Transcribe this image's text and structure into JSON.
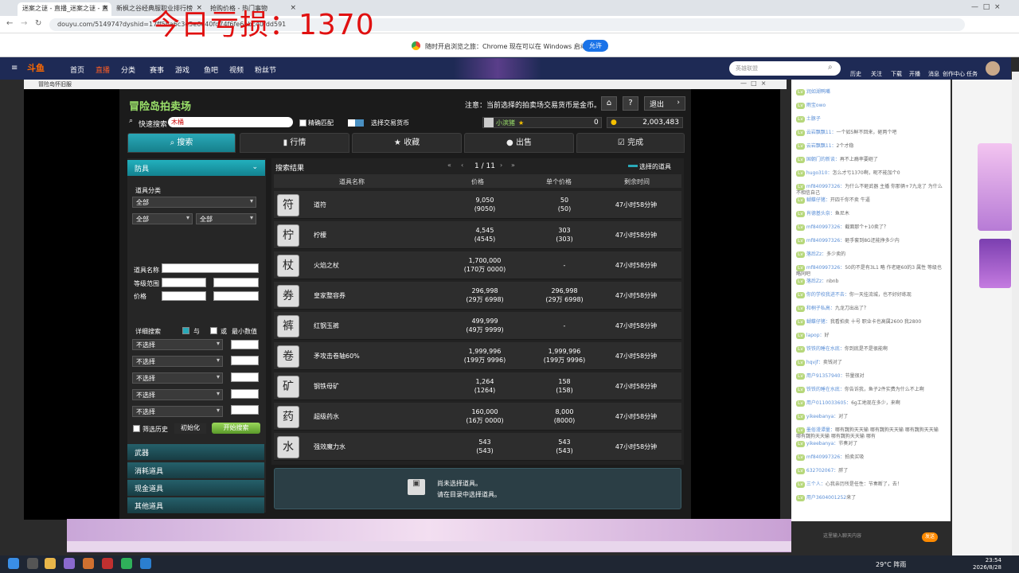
{
  "overlay": {
    "loss_text": "今日亏损：1370"
  },
  "browser": {
    "tabs": [
      {
        "label": "迷案之谜 - 直播_迷案之谜 - 直",
        "active": true
      },
      {
        "label": "新枫之谷经典服职业排行榜",
        "active": false
      },
      {
        "label": "抢购价格 - 热门事物",
        "active": false
      }
    ],
    "url": "douyu.com/514974?dyshid=17ff5ba6c3e5e6e40fd74f6fe6bbc40fdd591",
    "infobar_text": "随时开启浏览之旅：Chrome 现在可以在 Windows 启动时启动。",
    "infobar_button": "允许"
  },
  "site_nav": {
    "logo": "斗鱼",
    "items": [
      "首页",
      "直播",
      "分类",
      "赛事",
      "游戏",
      "鱼吧",
      "视频",
      "粉丝节"
    ],
    "search_placeholder": "英雄联盟",
    "right_items": [
      "历史",
      "关注",
      "下载",
      "开播",
      "消息",
      "创作中心",
      "任务"
    ]
  },
  "game_window": {
    "title": "冒险岛怀旧服",
    "auction_title": "冒险岛拍卖场",
    "notice": "注意：当前选择的拍卖场交易货币是金币。",
    "exit_label": "退出",
    "quick_search_label": "快速搜索",
    "quick_search_value": "木桶",
    "exact_match_label": "精确匹配",
    "currency_label": "选择交易货币",
    "player_name": "小滨猪",
    "player_points": "0",
    "meso": "2,003,483",
    "tabs": [
      "搜索",
      "行情",
      "收藏",
      "出售",
      "完成"
    ],
    "left": {
      "category_head": "防具",
      "item_category_label": "道具分类",
      "sel_all_1": "全部",
      "sel_all_2": "全部",
      "sel_all_3": "全部",
      "item_name_label": "道具名称",
      "level_range_label": "等级范围",
      "price_label": "价格",
      "detail_search_label": "详细搜索",
      "and_label": "与",
      "or_label": "或",
      "min_label": "最小数值",
      "not_selected": "不选择",
      "history_label": "筛选历史",
      "reset_label": "初始化",
      "start_label": "开始搜索",
      "categories": [
        "武器",
        "消耗道具",
        "现金道具",
        "其他道具"
      ]
    },
    "results": {
      "title": "搜索结果",
      "page": "1 / 11",
      "selected_items_label": "选择的道具",
      "columns": [
        "道具名称",
        "价格",
        "单个价格",
        "剩余时间"
      ],
      "rows": [
        {
          "icon": "符",
          "name": "道符",
          "price": "9,050",
          "price_sub": "(9050)",
          "unit": "50",
          "unit_sub": "(50)",
          "time": "47小时58分钟"
        },
        {
          "icon": "柠",
          "name": "柠檬",
          "price": "4,545",
          "price_sub": "(4545)",
          "unit": "303",
          "unit_sub": "(303)",
          "time": "47小时58分钟"
        },
        {
          "icon": "杖",
          "name": "火焰之杖",
          "price": "1,700,000",
          "price_sub": "(170万 0000)",
          "unit": "-",
          "unit_sub": "",
          "time": "47小时58分钟"
        },
        {
          "icon": "券",
          "name": "皇家整容券",
          "price": "296,998",
          "price_sub": "(29万 6998)",
          "unit": "296,998",
          "unit_sub": "(29万 6998)",
          "time": "47小时58分钟"
        },
        {
          "icon": "裤",
          "name": "红钢玉裤",
          "price": "499,999",
          "price_sub": "(49万 9999)",
          "unit": "-",
          "unit_sub": "",
          "time": "47小时58分钟"
        },
        {
          "icon": "卷",
          "name": "矛攻击卷轴60%",
          "price": "1,999,996",
          "price_sub": "(199万 9996)",
          "unit": "1,999,996",
          "unit_sub": "(199万 9996)",
          "time": "47小时58分钟"
        },
        {
          "icon": "矿",
          "name": "钢铁母矿",
          "price": "1,264",
          "price_sub": "(1264)",
          "unit": "158",
          "unit_sub": "(158)",
          "time": "47小时58分钟"
        },
        {
          "icon": "药",
          "name": "超级药水",
          "price": "160,000",
          "price_sub": "(16万 0000)",
          "unit": "8,000",
          "unit_sub": "(8000)",
          "time": "47小时58分钟"
        },
        {
          "icon": "水",
          "name": "强效魔力水",
          "price": "543",
          "price_sub": "(543)",
          "unit": "543",
          "unit_sub": "(543)",
          "time": "47小时58分钟"
        }
      ],
      "no_selection_line1": "尚未选择道具。",
      "no_selection_line2": "请在目录中选择道具。"
    }
  },
  "chat": {
    "lines": [
      {
        "user": "润如湖鸭嘴",
        "text": ""
      },
      {
        "user": "雨宝owo",
        "text": ""
      },
      {
        "user": "土豚子",
        "text": ""
      },
      {
        "user": "云岩飘飘11：",
        "text": "一个如5鲜不回来，砸两个吧"
      },
      {
        "user": "云岩飘飘11：",
        "text": "2个才稳"
      },
      {
        "user": "国朝门的新谈：",
        "text": "再不上瘾率要砸了"
      },
      {
        "user": "hugo310：",
        "text": "怎么才亏1370啊，昵不能加个0"
      },
      {
        "user": "mf840997326：",
        "text": "为什么不砸武器 主播 你那俩+7九龙了 为什么不相信自己"
      },
      {
        "user": "蝴蝶仔猪：",
        "text": "开四千你不卖 牛逼"
      },
      {
        "user": "肖德基头奈：",
        "text": "鱼尼木"
      },
      {
        "user": "mf840997326：",
        "text": "截面那个+10卖了？"
      },
      {
        "user": "mf840997326：",
        "text": "砸手套到8G还能挣多少内"
      },
      {
        "user": "落后Zz：",
        "text": "多少卖的"
      },
      {
        "user": "mf840997326：",
        "text": "50的不是有3L1 略 作老砸60的3 属性 等级也略同吧"
      },
      {
        "user": "落后Zz：",
        "text": "nbnb"
      },
      {
        "user": "你的学校我进不去：",
        "text": "你一天挂流城，也不好好练现"
      },
      {
        "user": "和桐子私高：",
        "text": "九龙刀出出了？"
      },
      {
        "user": "蝴蝶仔猪：",
        "text": "我看拍卖 十号 职业卡也高属2600 我2800"
      },
      {
        "user": "lapop：",
        "text": "好"
      },
      {
        "user": "铁铁的睡在水底：",
        "text": "你到底是不是很能啊"
      },
      {
        "user": "hqvjf：",
        "text": "卖钱对了"
      },
      {
        "user": "用户91357940：",
        "text": "节量很对"
      },
      {
        "user": "铁铁的睡在水底：",
        "text": "你告诉我，鱼子2件实费为什么不上啊"
      },
      {
        "user": "用户0110033605：",
        "text": "6g工地现在多少，来啊"
      },
      {
        "user": "yikeebanya：",
        "text": "对了"
      },
      {
        "user": "墨俗漫谭量：",
        "text": "哪有魏狗天天输 哪有魏狗天天输 哪有魏狗天天输 哪有魏狗天天输 哪有魏狗天天输 哪有"
      },
      {
        "user": "yikeebanya：",
        "text": "节奏对了"
      },
      {
        "user": "mf840997326：",
        "text": "拍卖买吸"
      },
      {
        "user": "632702067：",
        "text": "胖了"
      },
      {
        "user": "三个人：",
        "text": "心我亲历所是任性：节奏断了，去！"
      },
      {
        "user": "用户3604001252",
        "text": "来了"
      }
    ],
    "input_placeholder": "这里输入聊天内容",
    "send_label": "发送"
  },
  "taskbar": {
    "weather": "29°C 阵雨",
    "time": "23:54",
    "date": "2026/8/28"
  }
}
